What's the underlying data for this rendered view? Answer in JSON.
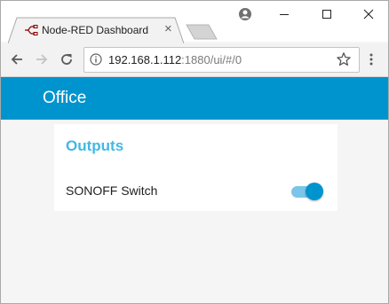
{
  "browser": {
    "tab": {
      "title": "Node-RED Dashboard",
      "close_glyph": "×"
    },
    "address": {
      "host": "192.168.1.112",
      "path": ":1880/ui/#/0"
    },
    "icons": [
      "tab-favicon-icon",
      "close-icon",
      "new-tab-icon",
      "profile-icon",
      "minimize-icon",
      "maximize-icon",
      "close-window-icon",
      "back-arrow-icon",
      "forward-arrow-icon",
      "reload-icon",
      "info-icon",
      "star-icon",
      "menu-dots-icon"
    ]
  },
  "dashboard": {
    "title": "Office",
    "group": {
      "title": "Outputs",
      "items": [
        {
          "label": "SONOFF Switch",
          "type": "switch",
          "state": "on"
        }
      ]
    },
    "colors": {
      "accent": "#0094ce",
      "group_title": "#42b8e6",
      "switch_track": "#7cc5e8"
    }
  }
}
